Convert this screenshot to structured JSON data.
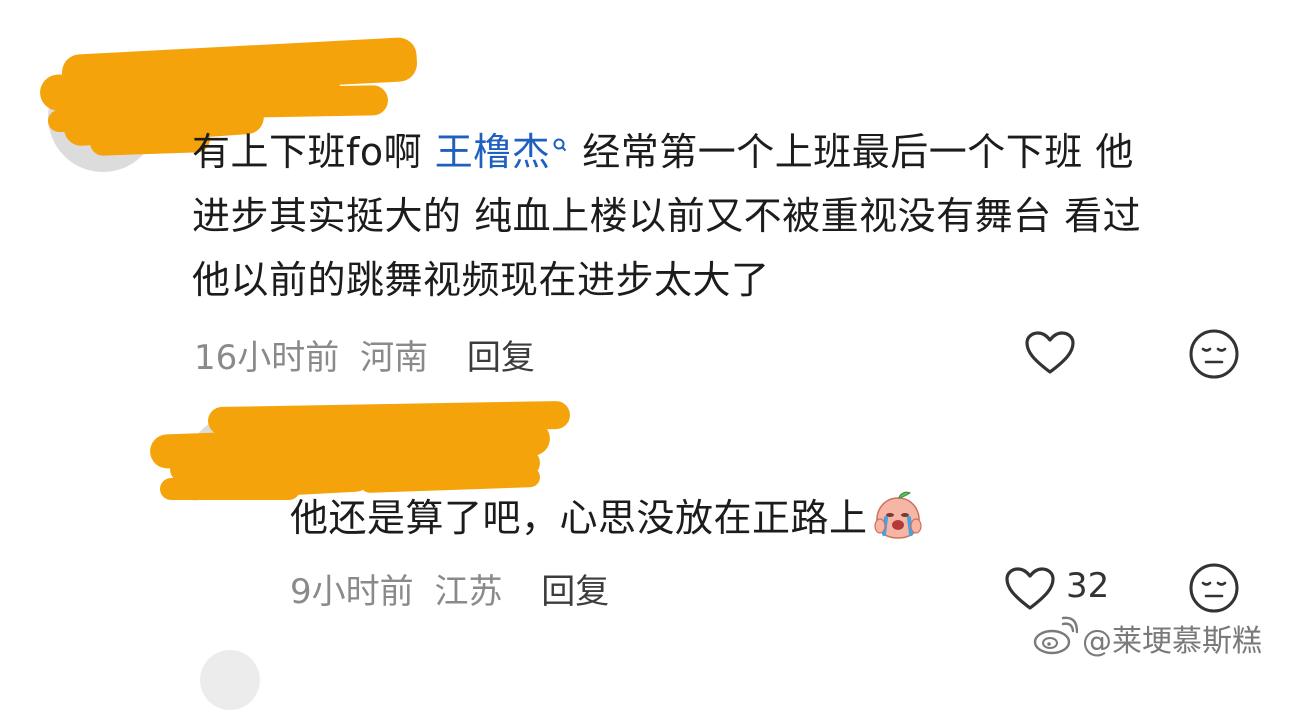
{
  "comments": [
    {
      "text_before": "有上下班fo啊 ",
      "mention": "王橹杰",
      "text_line1_after": "经常第一个上班最后一个下班 他",
      "text_line2": "进步其实挺大的 纯血上楼以前又不被重视没有舞台 看过",
      "text_line3": "他以前的跳舞视频现在进步太大了",
      "time": "16小时前",
      "location": "河南",
      "reply_label": "回复"
    },
    {
      "text": "他还是算了吧，心思没放在正路上",
      "time": "9小时前",
      "location": "江苏",
      "reply_label": "回复",
      "like_count": "32"
    }
  ],
  "watermark": {
    "handle": "@莱埂慕斯糕"
  },
  "icons": {
    "like": "heart-outline-icon",
    "dislike": "meh-face-icon",
    "mention_marker": "search-pin-icon",
    "sticker": "crying-peach-sticker",
    "watermark_logo": "weibo-logo-icon"
  },
  "colors": {
    "redaction": "#f5a30b",
    "mention": "#1f5fbf",
    "meta_text": "#8a8a8a",
    "body_text": "#1c1c1c"
  }
}
